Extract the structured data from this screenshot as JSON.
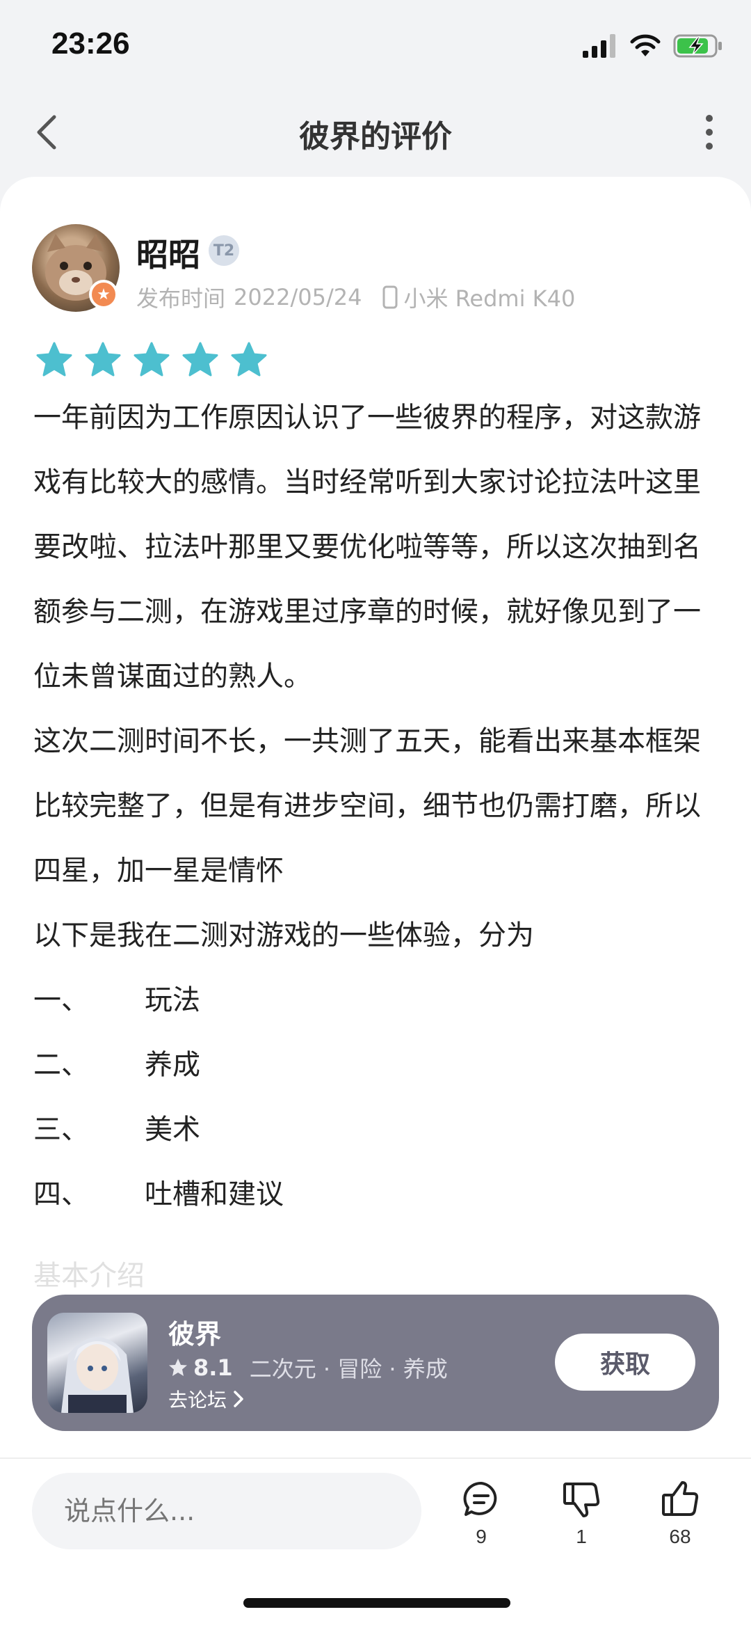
{
  "status_bar": {
    "time": "23:26"
  },
  "nav": {
    "title": "彼界的评价"
  },
  "user": {
    "name": "昭昭",
    "level_badge": "T2",
    "publish_label": "发布时间",
    "publish_date": "2022/05/24",
    "device": "小米 Redmi K40"
  },
  "rating": {
    "stars": 5,
    "color": "#4dbfcf"
  },
  "review": {
    "para1": "一年前因为工作原因认识了一些彼界的程序，对这款游戏有比较大的感情。当时经常听到大家讨论拉法叶这里要改啦、拉法叶那里又要优化啦等等，所以这次抽到名额参与二测，在游戏里过序章的时候，就好像见到了一位未曾谋面过的熟人。",
    "para2": "这次二测时间不长，一共测了五天，能看出来基本框架比较完整了，但是有进步空间，细节也仍需打磨，所以四星，加一星是情怀",
    "para3": "以下是我在二测对游戏的一些体验，分为",
    "list": [
      {
        "num": "一、",
        "text": "玩法"
      },
      {
        "num": "二、",
        "text": "养成"
      },
      {
        "num": "三、",
        "text": "美术"
      },
      {
        "num": "四、",
        "text": "吐槽和建议"
      }
    ],
    "next_section": "基本介绍"
  },
  "app_card": {
    "name": "彼界",
    "score": "8.1",
    "tags": "二次元 · 冒险 · 养成",
    "forum_link": "去论坛",
    "get_button": "获取"
  },
  "bottom_bar": {
    "input_placeholder": "说点什么...",
    "comments": "9",
    "dislikes": "1",
    "likes": "68"
  }
}
